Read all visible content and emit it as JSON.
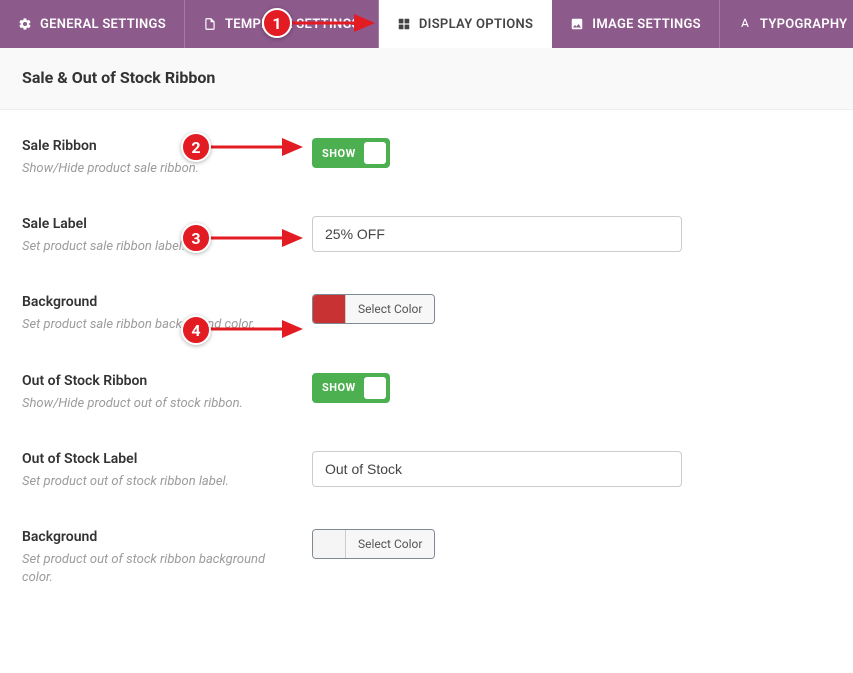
{
  "tabs": [
    {
      "label": "GENERAL SETTINGS",
      "icon": "gear"
    },
    {
      "label": "TEMPLATE SETTINGS",
      "icon": "template"
    },
    {
      "label": "DISPLAY OPTIONS",
      "icon": "grid"
    },
    {
      "label": "IMAGE SETTINGS",
      "icon": "image"
    },
    {
      "label": "TYPOGRAPHY",
      "icon": "font"
    }
  ],
  "section": {
    "title": "Sale & Out of Stock Ribbon"
  },
  "fields": {
    "sale_ribbon": {
      "label": "Sale Ribbon",
      "help": "Show/Hide product sale ribbon.",
      "toggle": "SHOW"
    },
    "sale_label": {
      "label": "Sale Label",
      "help": "Set product sale ribbon label.",
      "value": "25% OFF"
    },
    "sale_background": {
      "label": "Background",
      "help": "Set product sale ribbon background color.",
      "color_btn": "Select Color",
      "color": "#c93232"
    },
    "oos_ribbon": {
      "label": "Out of Stock Ribbon",
      "help": "Show/Hide product out of stock ribbon.",
      "toggle": "SHOW"
    },
    "oos_label": {
      "label": "Out of Stock Label",
      "help": "Set product out of stock ribbon label.",
      "value": "Out of Stock"
    },
    "oos_background": {
      "label": "Background",
      "help": "Set product out of stock ribbon background color.",
      "color_btn": "Select Color"
    }
  },
  "callouts": {
    "c1": "1",
    "c2": "2",
    "c3": "3",
    "c4": "4"
  }
}
